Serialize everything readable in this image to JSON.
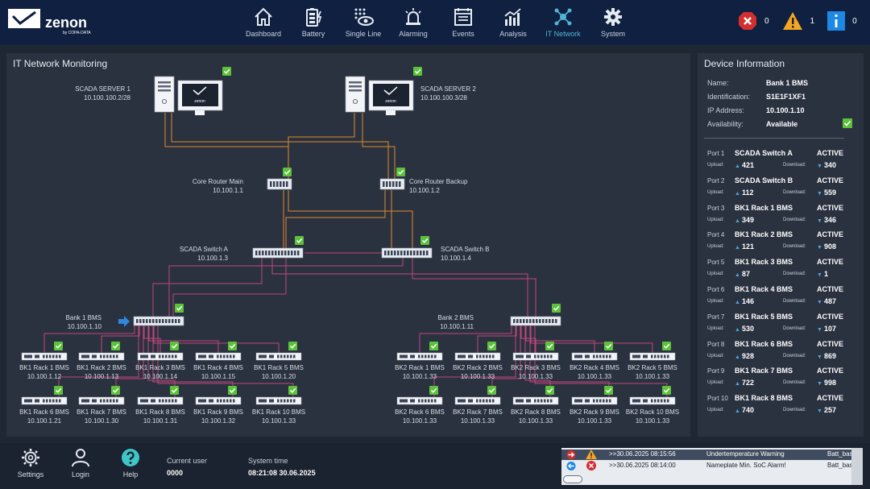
{
  "app": {
    "logo_text": "zenon",
    "logo_sub": "by COPA-DATA"
  },
  "nav": [
    {
      "label": "Dashboard",
      "icon": "home-icon"
    },
    {
      "label": "Battery",
      "icon": "battery-icon"
    },
    {
      "label": "Single Line",
      "icon": "grid-eye-icon"
    },
    {
      "label": "Alarming",
      "icon": "siren-icon"
    },
    {
      "label": "Events",
      "icon": "list-icon"
    },
    {
      "label": "Analysis",
      "icon": "chart-icon"
    },
    {
      "label": "IT Network",
      "icon": "network-icon"
    },
    {
      "label": "System",
      "icon": "gear-icon"
    }
  ],
  "status": {
    "error_count": "0",
    "warning_count": "1",
    "info_count": "0"
  },
  "network": {
    "title": "IT Network Monitoring",
    "server1": {
      "name": "SCADA SERVER 1",
      "ip": "10.100.100.2/28",
      "screen_text": "zenon"
    },
    "server2": {
      "name": "SCADA SERVER 2",
      "ip": "10.100.100.3/28",
      "screen_text": "zenon"
    },
    "router_main": {
      "name": "Core Router Main",
      "ip": "10.100.1.1"
    },
    "router_backup": {
      "name": "Core Router Backup",
      "ip": "10.100.1.2"
    },
    "switch_a": {
      "name": "SCADA Switch A",
      "ip": "10.100.1.3"
    },
    "switch_b": {
      "name": "SCADA Switch B",
      "ip": "10.100.1.4"
    },
    "bank1": {
      "name": "Bank 1 BMS",
      "ip": "10.100.1.10"
    },
    "bank2": {
      "name": "Bank 2 BMS",
      "ip": "10.100.1.11"
    },
    "bank1_racks": [
      {
        "name": "BK1 Rack 1 BMS",
        "ip": "10.100.1.12"
      },
      {
        "name": "BK1 Rack 2 BMS",
        "ip": "10.100.1.13"
      },
      {
        "name": "BK1 Rack 3 BMS",
        "ip": "10.100.1.14"
      },
      {
        "name": "BK1 Rack 4 BMS",
        "ip": "10.100.1.15"
      },
      {
        "name": "BK1 Rack 5 BMS",
        "ip": "10.100.1.20"
      },
      {
        "name": "BK1 Rack 6 BMS",
        "ip": "10.100.1.21"
      },
      {
        "name": "BK1 Rack 7 BMS",
        "ip": "10.100.1.30"
      },
      {
        "name": "BK1 Rack 8 BMS",
        "ip": "10.100.1.31"
      },
      {
        "name": "BK1 Rack 9 BMS",
        "ip": "10.100.1.32"
      },
      {
        "name": "BK1 Rack 10 BMS",
        "ip": "10.100.1.33"
      }
    ],
    "bank2_racks": [
      {
        "name": "BK2 Rack 1 BMS",
        "ip": "10.100.1.33"
      },
      {
        "name": "BK2 Rack 2 BMS",
        "ip": "10.100.1.33"
      },
      {
        "name": "BK2 Rack 3 BMS",
        "ip": "10.100.1.33"
      },
      {
        "name": "BK2 Rack 4 BMS",
        "ip": "10.100.1.33"
      },
      {
        "name": "BK2 Rack 5 BMS",
        "ip": "10.100.1.33"
      },
      {
        "name": "BK2 Rack 6 BMS",
        "ip": "10.100.1.33"
      },
      {
        "name": "BK2 Rack 7 BMS",
        "ip": "10.100.1.33"
      },
      {
        "name": "BK2 Rack 8 BMS",
        "ip": "10.100.1.33"
      },
      {
        "name": "BK2 Rack 9 BMS",
        "ip": "10.100.1.33"
      },
      {
        "name": "BK2 Rack 10 BMS",
        "ip": "10.100.1.33"
      }
    ],
    "colors": {
      "orange_link": "#e0892a",
      "pink_link": "#c2477a",
      "ok_green": "#5cc23a",
      "selected_arrow": "#2e86de"
    }
  },
  "device": {
    "title": "Device Information",
    "name_label": "Name:",
    "name": "Bank 1 BMS",
    "id_label": "Identification:",
    "id": "S1E1F1XF1",
    "ip_label": "IP Address:",
    "ip": "10.100.1.10",
    "avail_label": "Availability:",
    "avail": "Available",
    "upload_label": "Upload:",
    "download_label": "Download:",
    "ports": [
      {
        "port": "Port 1",
        "name": "SCADA Switch A",
        "state": "ACTIVE",
        "up": "421",
        "down": "340"
      },
      {
        "port": "Port 2",
        "name": "SCADA Switch B",
        "state": "ACTIVE",
        "up": "112",
        "down": "559"
      },
      {
        "port": "Port 3",
        "name": "BK1 Rack 1 BMS",
        "state": "ACTIVE",
        "up": "349",
        "down": "346"
      },
      {
        "port": "Port 4",
        "name": "BK1 Rack 2 BMS",
        "state": "ACTIVE",
        "up": "121",
        "down": "908"
      },
      {
        "port": "Port 5",
        "name": "BK1 Rack 3 BMS",
        "state": "ACTIVE",
        "up": "87",
        "down": "1"
      },
      {
        "port": "Port 6",
        "name": "BK1 Rack 4 BMS",
        "state": "ACTIVE",
        "up": "146",
        "down": "487"
      },
      {
        "port": "Port 7",
        "name": "BK1 Rack 5 BMS",
        "state": "ACTIVE",
        "up": "530",
        "down": "107"
      },
      {
        "port": "Port 8",
        "name": "BK1 Rack 6 BMS",
        "state": "ACTIVE",
        "up": "928",
        "down": "869"
      },
      {
        "port": "Port 9",
        "name": "BK1 Rack 7 BMS",
        "state": "ACTIVE",
        "up": "722",
        "down": "998"
      },
      {
        "port": "Port 10",
        "name": "BK1 Rack 8 BMS",
        "state": "ACTIVE",
        "up": "740",
        "down": "257"
      }
    ]
  },
  "bottom": {
    "settings": "Settings",
    "login": "Login",
    "help": "Help",
    "user_label": "Current user",
    "user": "0000",
    "time_label": "System time",
    "time": "08:21:08 30.06.2025"
  },
  "alarms": [
    {
      "time": ">>30.06.2025 08:15:56",
      "text": "Undertemperature Warning",
      "source": "Batt_bas",
      "type": "warning"
    },
    {
      "time": ">>30.06.2025 08:14:00",
      "text": "Nameplate Min. SoC Alarm!",
      "source": "Batt_bas",
      "type": "error"
    }
  ]
}
